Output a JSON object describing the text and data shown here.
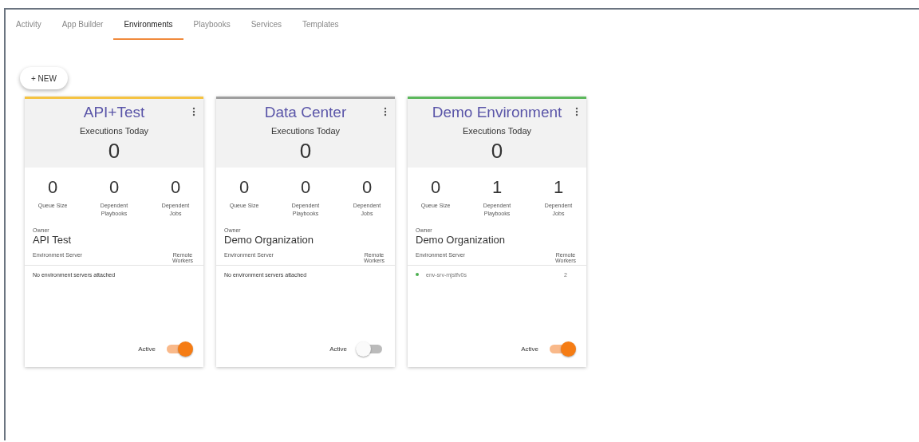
{
  "tabs": [
    {
      "label": "Activity",
      "selected": false
    },
    {
      "label": "App Builder",
      "selected": false
    },
    {
      "label": "Environments",
      "selected": true
    },
    {
      "label": "Playbooks",
      "selected": false
    },
    {
      "label": "Services",
      "selected": false
    },
    {
      "label": "Templates",
      "selected": false
    }
  ],
  "new_button": "+ NEW",
  "environments": [
    {
      "name": "API+Test",
      "color": "#f5c342",
      "executions_label": "Executions Today",
      "executions": "0",
      "stats": [
        {
          "value": "0",
          "label": "Queue Size"
        },
        {
          "value": "0",
          "label": "Dependent Playbooks"
        },
        {
          "value": "0",
          "label": "Dependent Jobs"
        }
      ],
      "owner_label": "Owner",
      "owner": "API Test",
      "server_header": "Environment Server",
      "workers_header": "Remote Workers",
      "empty_message": "No environment servers attached",
      "active_label": "Active",
      "active": true
    },
    {
      "name": "Data Center",
      "color": "#9e9e9e",
      "executions_label": "Executions Today",
      "executions": "0",
      "stats": [
        {
          "value": "0",
          "label": "Queue Size"
        },
        {
          "value": "0",
          "label": "Dependent Playbooks"
        },
        {
          "value": "0",
          "label": "Dependent Jobs"
        }
      ],
      "owner_label": "Owner",
      "owner": "Demo Organization",
      "server_header": "Environment Server",
      "workers_header": "Remote Workers",
      "empty_message": "No environment servers attached",
      "active_label": "Active",
      "active": false
    },
    {
      "name": "Demo Environment",
      "color": "#5cb85c",
      "executions_label": "Executions Today",
      "executions": "0",
      "stats": [
        {
          "value": "0",
          "label": "Queue Size"
        },
        {
          "value": "1",
          "label": "Dependent Playbooks"
        },
        {
          "value": "1",
          "label": "Dependent Jobs"
        }
      ],
      "owner_label": "Owner",
      "owner": "Demo Organization",
      "server_header": "Environment Server",
      "workers_header": "Remote Workers",
      "servers": [
        {
          "name": "env-srv-mjstfv0s",
          "workers": "2",
          "color": "#4caf50"
        }
      ],
      "active_label": "Active",
      "active": true
    }
  ]
}
